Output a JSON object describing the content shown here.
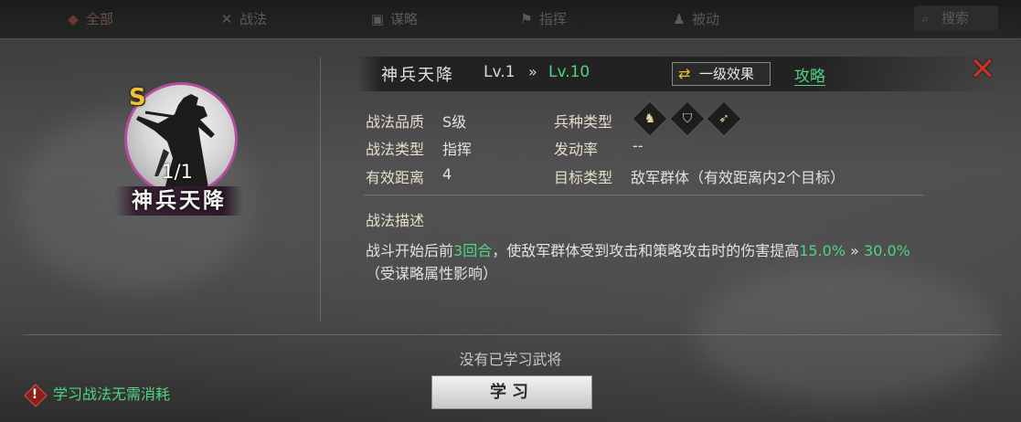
{
  "top_tabs": [
    {
      "label": "全部",
      "icon": "category-icon"
    },
    {
      "label": "战法",
      "icon": "close-icon"
    },
    {
      "label": "谋略",
      "icon": "scroll-icon"
    },
    {
      "label": "指挥",
      "icon": "flag-icon"
    },
    {
      "label": "被动",
      "icon": "person-icon"
    }
  ],
  "search_label": "搜索",
  "skill": {
    "grade_badge": "S",
    "count": "1/1",
    "name": "神兵天降",
    "level_current": "Lv.1",
    "level_arrow": "»",
    "level_max": "Lv.10",
    "effect_button_icon": "⇄",
    "effect_button_label": "一级效果",
    "guide_link": "攻略",
    "close_icon": "✕"
  },
  "attributes": {
    "quality_label": "战法品质",
    "quality_value": "S级",
    "type_label": "战法类型",
    "type_value": "指挥",
    "range_label": "有效距离",
    "range_value": "4",
    "troop_label": "兵种类型",
    "trigger_label": "发动率",
    "trigger_value": "--",
    "target_label": "目标类型",
    "target_value": "敌军群体（有效距离内2个目标）",
    "troop_icons": [
      "cavalry-icon",
      "shield-icon",
      "bow-icon"
    ]
  },
  "description": {
    "title": "战法描述",
    "part1": "战斗开始后前",
    "hl1": "3回合",
    "part2": "，使敌军群体受到攻击和策略攻击时的伤害提高",
    "hl2": "15.0%",
    "arrow": " » ",
    "hl3": "30.0%",
    "part3": "（受谋略属性影响）"
  },
  "footer": {
    "no_general": "没有已学习武将",
    "learn_button": "学习",
    "tip_icon": "!",
    "tip_text": "学习战法无需消耗"
  },
  "colors": {
    "accent_green": "#4fd483",
    "grade_gold": "#f0c232",
    "portrait_ring": "#b44d9b",
    "close_red": "#c9302c"
  }
}
